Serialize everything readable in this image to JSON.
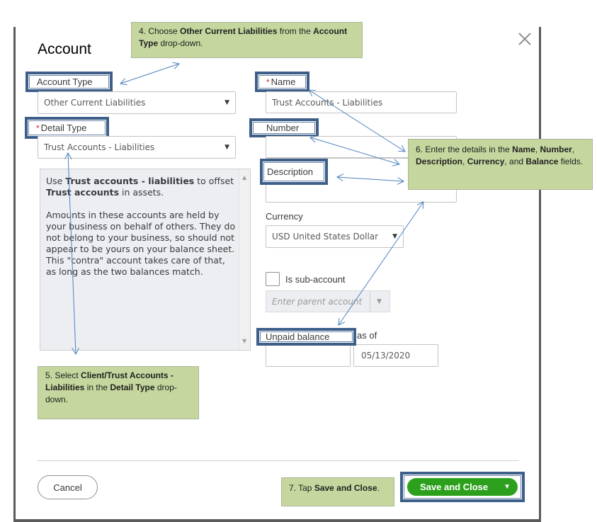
{
  "dialog": {
    "title": "Account",
    "close_icon": "close-icon"
  },
  "form": {
    "account_type": {
      "label": "Account Type",
      "value": "Other Current Liabilities"
    },
    "detail_type": {
      "label": "Detail Type",
      "required_marker": "*",
      "value": "Trust Accounts - Liabilities"
    },
    "detail_description": {
      "para1_prefix": "Use ",
      "para1_bold1": "Trust accounts - liabilities",
      "para1_mid": " to offset ",
      "para1_bold2": "Trust accounts",
      "para1_suffix": " in assets.",
      "para2": "Amounts in these accounts are held by your business on behalf of others. They do not belong to your business, so should not appear to be yours on your balance sheet. This \"contra\" account takes care of that, as long as the two balances match."
    },
    "name": {
      "label": "Name",
      "required_marker": "*",
      "value": "Trust Accounts - Liabilities"
    },
    "number": {
      "label": "Number",
      "value": ""
    },
    "description": {
      "label": "Description",
      "value": ""
    },
    "currency": {
      "label": "Currency",
      "value": "USD United States Dollar"
    },
    "sub_account": {
      "label": "Is sub-account",
      "checked": false,
      "parent_placeholder": "Enter parent account"
    },
    "unpaid_balance": {
      "label": "Unpaid balance",
      "value": ""
    },
    "as_of": {
      "label": "as of",
      "value": "05/13/2020"
    }
  },
  "footer": {
    "cancel_label": "Cancel",
    "save_label": "Save and Close"
  },
  "callouts": {
    "step4": {
      "prefix": "4. Choose ",
      "bold1": "Other Current Liabilities",
      "mid": " from the ",
      "bold2": "Account Type",
      "suffix": " drop-down."
    },
    "step5": {
      "prefix": "5. Select ",
      "bold1": "Client/Trust Accounts - Liabilities",
      "mid": " in the ",
      "bold2": "Detail Type",
      "suffix": " drop-down."
    },
    "step6": {
      "prefix": "6. Enter the details in the ",
      "bold1": "Name",
      "sep1": ", ",
      "bold2": "Number",
      "sep2": ", ",
      "bold3": "Description",
      "sep3": ", ",
      "bold4": "Currency",
      "mid": ", and ",
      "bold5": "Balance",
      "suffix": " fields."
    },
    "step7": {
      "prefix": "7. Tap ",
      "bold1": "Save and Close",
      "suffix": "."
    }
  },
  "colors": {
    "primary_green": "#2ca01c",
    "highlight_border": "#3e5f8a",
    "callout_bg": "#c5d79e",
    "required_red": "#d52b1e",
    "arrow_blue": "#4f81bd"
  }
}
